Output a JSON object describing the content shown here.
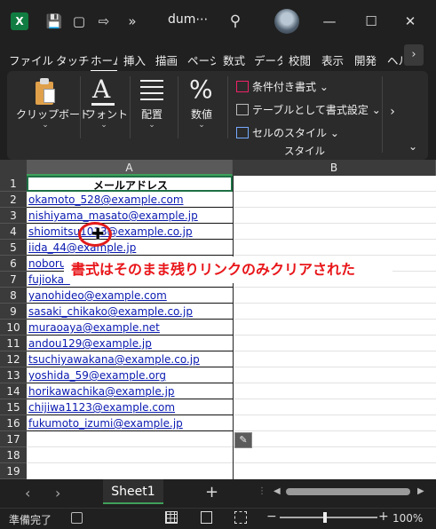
{
  "titlebar": {
    "doc_title": "dum⋯",
    "more": "»",
    "minimize": "—",
    "maximize": "☐",
    "close": "✕",
    "logo": "X"
  },
  "tabs": [
    "ファイル",
    "タッチ",
    "ホーム",
    "挿入",
    "描画",
    "ページ",
    "数式",
    "データ",
    "校閲",
    "表示",
    "開発",
    "ヘルプ"
  ],
  "tab_scroll": "›",
  "ribbon": {
    "clipboard": "クリップボード",
    "font": "フォント",
    "alignment": "配置",
    "number": "数値",
    "cond_format": "条件付き書式 ⌄",
    "format_table": "テーブルとして書式設定 ⌄",
    "cell_styles": "セルのスタイル ⌄",
    "styles_group": "スタイル",
    "chevron": "⌄",
    "more": "›",
    "collapse": "⌄"
  },
  "columns": [
    "A",
    "B"
  ],
  "rows": [
    "1",
    "2",
    "3",
    "4",
    "5",
    "6",
    "7",
    "8",
    "9",
    "10",
    "11",
    "12",
    "13",
    "14",
    "15",
    "16",
    "17",
    "18",
    "19"
  ],
  "cells": {
    "a1": "メールアドレス",
    "emails": [
      "okamoto_528@example.com",
      "nishiyama_masato@example.jp",
      "shiomitsu1013@example.co.jp",
      "iida_44@example.jp",
      "noboru",
      "fujiokak",
      "yanohideo@example.com",
      "sasaki_chikako@example.co.jp",
      "muraoaya@example.net",
      "andou129@example.jp",
      "tsuchiyawakana@example.co.jp",
      "yoshida_59@example.org",
      "horikawachika@example.jp",
      "chijiwa1123@example.com",
      "fukumoto_izumi@example.jp"
    ]
  },
  "callout": "書式はそのまま残りリンクのみクリアされた",
  "cursor": "✚",
  "sheet_tab": "Sheet1",
  "add_sheet": "+",
  "nav_prev": "‹",
  "nav_next": "›",
  "status": {
    "ready": "準備完了",
    "zoom_minus": "−",
    "zoom_plus": "+",
    "zoom": "100%"
  },
  "colors": {
    "accent_green": "#107c41",
    "link_blue": "#0a1ab0",
    "callout_red": "#e8161a"
  }
}
